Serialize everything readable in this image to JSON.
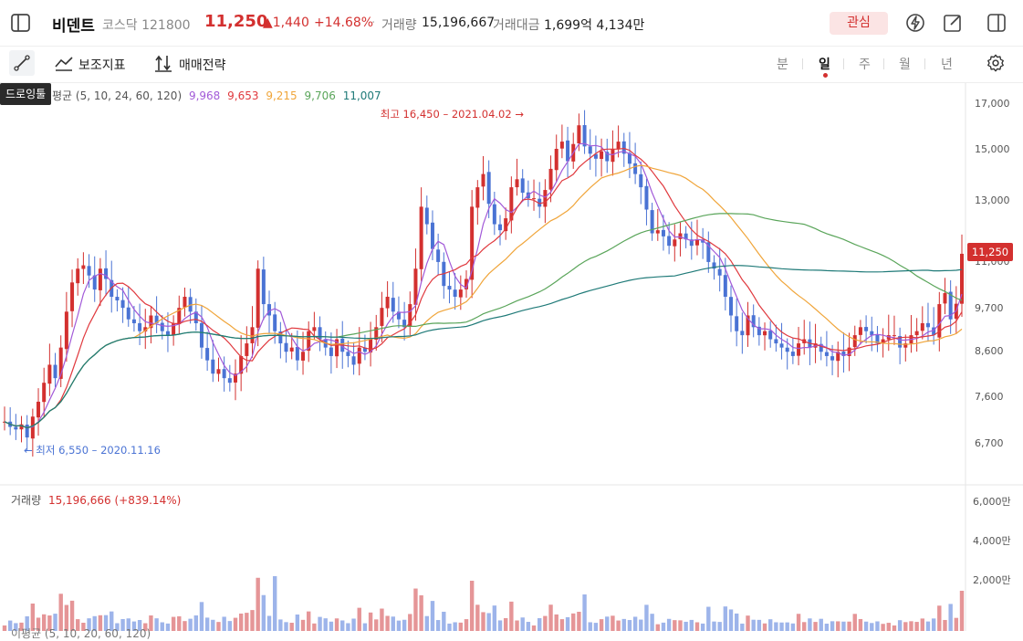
{
  "header": {
    "stock_name": "비덴트",
    "market": "코스닥",
    "code": "121800",
    "price": "11,250",
    "change": "▲1,440",
    "change_pct": "+14.68%",
    "volume_label": "거래량",
    "volume": "15,196,667",
    "amount_label": "거래대금",
    "amount": "1,699억 4,134만",
    "favorite_label": "관심",
    "icons": [
      "sidebar-toggle-icon",
      "flash-icon",
      "edit-icon",
      "panel-icon"
    ]
  },
  "toolbar": {
    "indicator_label": "보조지표",
    "strategy_label": "매매전략",
    "drawing_tooltip": "드로잉툴",
    "periods": [
      "분",
      "일",
      "주",
      "월",
      "년"
    ],
    "active_period": "일"
  },
  "ma_legend": {
    "label": "평균 (5, 10, 24, 60, 120)",
    "values": [
      "9,968",
      "9,653",
      "9,215",
      "9,706",
      "11,007"
    ],
    "colors": [
      "#a25ad8",
      "#e0393e",
      "#f0a53a",
      "#5aa55a",
      "#1f7a78"
    ]
  },
  "annotations": {
    "high": "최고 16,450 – 2021.04.02 →",
    "low": "← 최저 6,550 – 2020.11.16"
  },
  "price_axis": [
    "17,000",
    "15,000",
    "13,000",
    "11,000",
    "9,700",
    "8,600",
    "7,600",
    "6,700"
  ],
  "current_price_tag": "11,250",
  "volume_panel": {
    "label": "거래량",
    "value": "15,196,666 (+839.14%)",
    "axis": [
      "6,000만",
      "4,000만",
      "2,000만"
    ]
  },
  "bottom_legend": "이평균 (5, 10, 20, 60, 120)",
  "colors": {
    "up": "#d3302f",
    "down": "#4a73d4",
    "up_vol": "#e59597",
    "down_vol": "#9db4ea"
  },
  "chart_data": {
    "type": "candlestick",
    "x_range": [
      "2020-11",
      "2021-08"
    ],
    "y_range": [
      6400,
      17400
    ],
    "closes": [
      7100,
      7000,
      6950,
      7050,
      6800,
      7200,
      7500,
      7900,
      8300,
      8000,
      8700,
      9600,
      10400,
      10800,
      10900,
      10600,
      10200,
      10800,
      10500,
      10000,
      9900,
      9700,
      9400,
      9300,
      9100,
      9200,
      9500,
      9300,
      9100,
      9000,
      9300,
      9700,
      10000,
      9600,
      9300,
      8700,
      8400,
      8100,
      8200,
      8000,
      7900,
      8100,
      8500,
      8800,
      9200,
      10800,
      9800,
      9500,
      9100,
      8800,
      8600,
      8700,
      8400,
      8600,
      9100,
      9200,
      8900,
      8700,
      8500,
      8900,
      8600,
      8500,
      8300,
      8700,
      8600,
      8900,
      9200,
      9700,
      10000,
      9600,
      9400,
      9200,
      9800,
      10800,
      12800,
      12200,
      11400,
      11000,
      10300,
      10200,
      10000,
      10200,
      10500,
      12800,
      13500,
      14000,
      12900,
      12200,
      12000,
      12400,
      13500,
      13800,
      13300,
      13100,
      13100,
      12800,
      13400,
      14200,
      15000,
      15300,
      14500,
      15200,
      16000,
      15100,
      14800,
      14600,
      14900,
      14500,
      15000,
      15300,
      14800,
      14400,
      14000,
      13500,
      12700,
      11900,
      12000,
      11800,
      11500,
      11700,
      11900,
      11700,
      11500,
      11700,
      11600,
      11000,
      10800,
      10600,
      10000,
      9500,
      9100,
      9000,
      9500,
      9200,
      9000,
      9100,
      8900,
      8800,
      8700,
      8600,
      8500,
      8800,
      8900,
      8700,
      8800,
      8600,
      8500,
      8400,
      8600,
      8500,
      8700,
      9000,
      9200,
      9100,
      9000,
      8800,
      8900,
      9000,
      9000,
      8700,
      8800,
      9000,
      9100,
      9300,
      9200,
      9000,
      9800,
      10100,
      9400,
      9810,
      11250
    ]
  }
}
